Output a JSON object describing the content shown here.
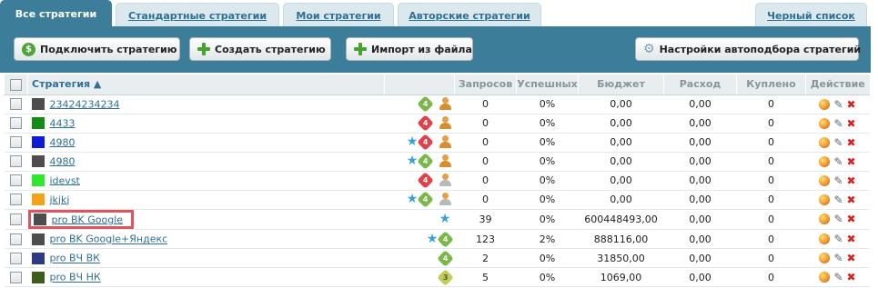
{
  "tabs": [
    {
      "label": "Все стратегии",
      "active": true
    },
    {
      "label": "Стандартные стратегии",
      "active": false
    },
    {
      "label": "Мои стратегии",
      "active": false
    },
    {
      "label": "Авторские стратегии",
      "active": false
    },
    {
      "label": "Черный список",
      "active": false
    }
  ],
  "toolbar": {
    "connect_label": "Подключить стратегию",
    "create_label": "Создать стратегию",
    "import_label": "Импорт из файла",
    "settings_label": "Настройки автоподбора стратегий",
    "connect_icon_glyph": "$"
  },
  "table": {
    "columns": [
      "Стратегия ▲",
      "Запросов",
      "Успешных",
      "Бюджет",
      "Расход",
      "Куплено",
      "Действие"
    ],
    "rows": [
      {
        "color": "#4d4d4d",
        "name": "23424234234",
        "star": false,
        "sticker": "green",
        "sticker_num": "4",
        "owner": "user",
        "queries": "0",
        "success": "0%",
        "budget": "0,00",
        "spend": "0,00",
        "bought": "0"
      },
      {
        "color": "#128c12",
        "name": "4433",
        "star": false,
        "sticker": "red",
        "sticker_num": "4",
        "owner": "user",
        "queries": "0",
        "success": "0%",
        "budget": "0,00",
        "spend": "0,00",
        "bought": "0"
      },
      {
        "color": "#0e1bd8",
        "name": "4980",
        "star": true,
        "sticker": "red",
        "sticker_num": "4",
        "owner": "user",
        "queries": "0",
        "success": "0%",
        "budget": "0,00",
        "spend": "0,00",
        "bought": "0"
      },
      {
        "color": "#4d4d4d",
        "name": "4980",
        "star": true,
        "sticker": "green",
        "sticker_num": "4",
        "owner": "user",
        "queries": "0",
        "success": "0%",
        "budget": "0,00",
        "spend": "0,00",
        "bought": "0"
      },
      {
        "color": "#2ee82e",
        "name": "idevst",
        "star": false,
        "sticker": "red",
        "sticker_num": "4",
        "owner": "user-alt",
        "queries": "0",
        "success": "0%",
        "budget": "0,00",
        "spend": "0,00",
        "bought": "0"
      },
      {
        "color": "#f5a21b",
        "name": "jkjkj",
        "star": true,
        "sticker": "green",
        "sticker_num": "4",
        "owner": "user-alt",
        "queries": "0",
        "success": "0%",
        "budget": "0,00",
        "spend": "0,00",
        "bought": "0"
      },
      {
        "color": "#4d4d4d",
        "name": "pro BK Google",
        "star": true,
        "sticker": "",
        "sticker_num": "",
        "owner": "",
        "highlighted": true,
        "queries": "39",
        "success": "0%",
        "budget": "600448493,00",
        "spend": "0,00",
        "bought": "0"
      },
      {
        "color": "#4d4d4d",
        "name": "pro BK Google+Яндекс",
        "star": true,
        "sticker": "green",
        "sticker_num": "4",
        "owner": "",
        "queries": "123",
        "success": "2%",
        "budget": "888116,00",
        "spend": "0,00",
        "bought": "0"
      },
      {
        "color": "#2d3a86",
        "name": "pro ВЧ ВК",
        "star": false,
        "sticker": "green",
        "sticker_num": "4",
        "owner": "",
        "queries": "2",
        "success": "0%",
        "budget": "31850,00",
        "spend": "0,00",
        "bought": "0"
      },
      {
        "color": "#3c5d1c",
        "name": "pro ВЧ НК",
        "star": false,
        "sticker": "lime",
        "sticker_num": "3",
        "owner": "",
        "queries": "5",
        "success": "0%",
        "budget": "1069,00",
        "spend": "0,00",
        "bought": "0"
      }
    ]
  },
  "icons": {
    "star_glyph": "★",
    "edit_glyph": "✎",
    "delete_glyph": "✖",
    "gear_glyph": "⚙"
  }
}
